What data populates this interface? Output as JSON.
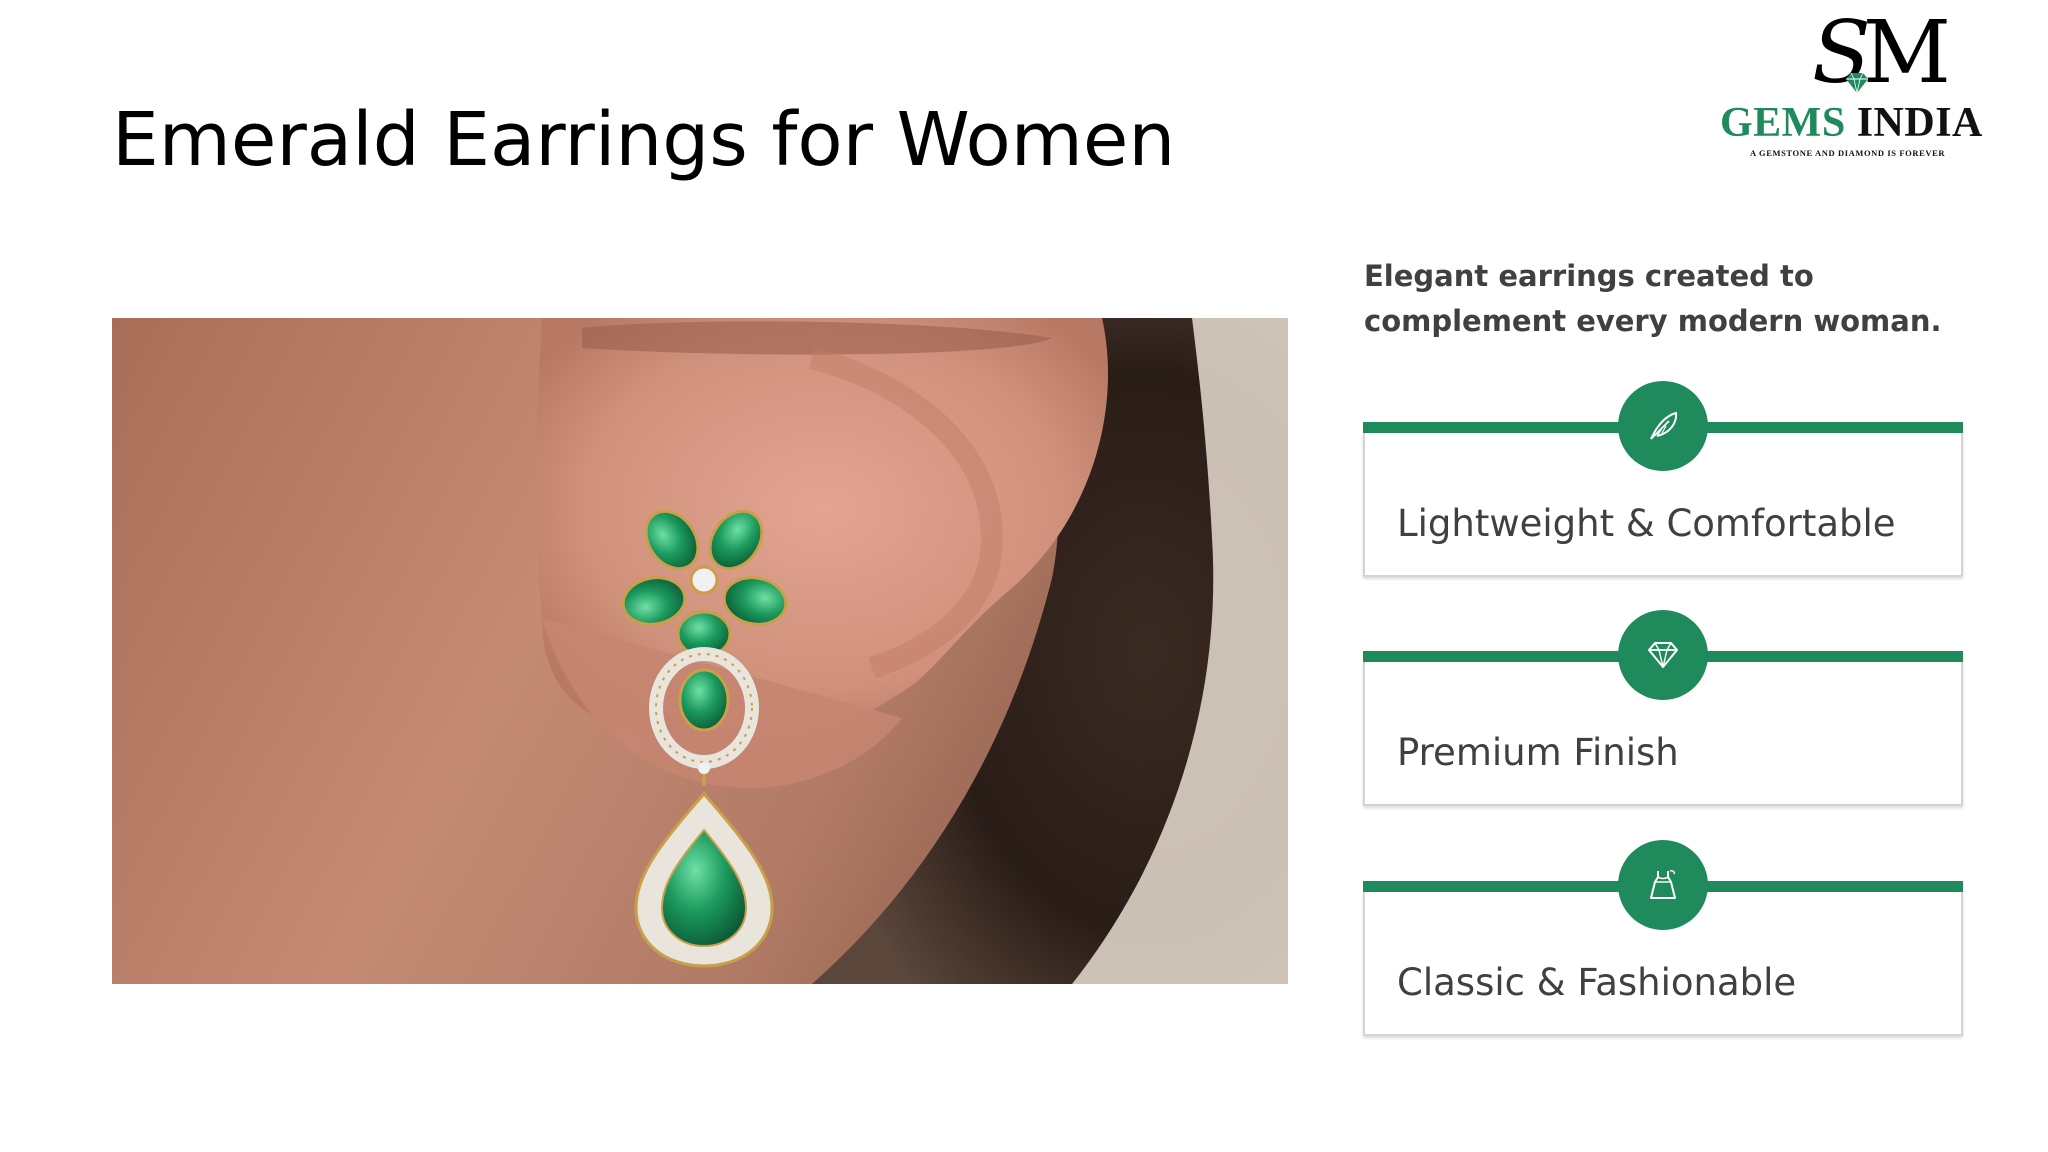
{
  "title": "Emerald Earrings for Women",
  "logo": {
    "monogram_s": "S",
    "monogram_m": "M",
    "name_part1": "GEMS",
    "name_part2": "INDIA",
    "tagline": "A GEMSTONE AND DIAMOND IS FOREVER",
    "icon": "diamond-icon"
  },
  "intro_text": "Elegant earrings created to complement every modern woman.",
  "features": [
    {
      "label": "Lightweight & Comfortable",
      "icon": "feather-icon"
    },
    {
      "label": "Premium Finish",
      "icon": "diamond-icon"
    },
    {
      "label": "Classic & Fashionable",
      "icon": "dress-icon"
    }
  ],
  "colors": {
    "accent": "#1f8a5c",
    "text": "#404040",
    "title": "#000000",
    "card_border": "#d4d4d4"
  }
}
